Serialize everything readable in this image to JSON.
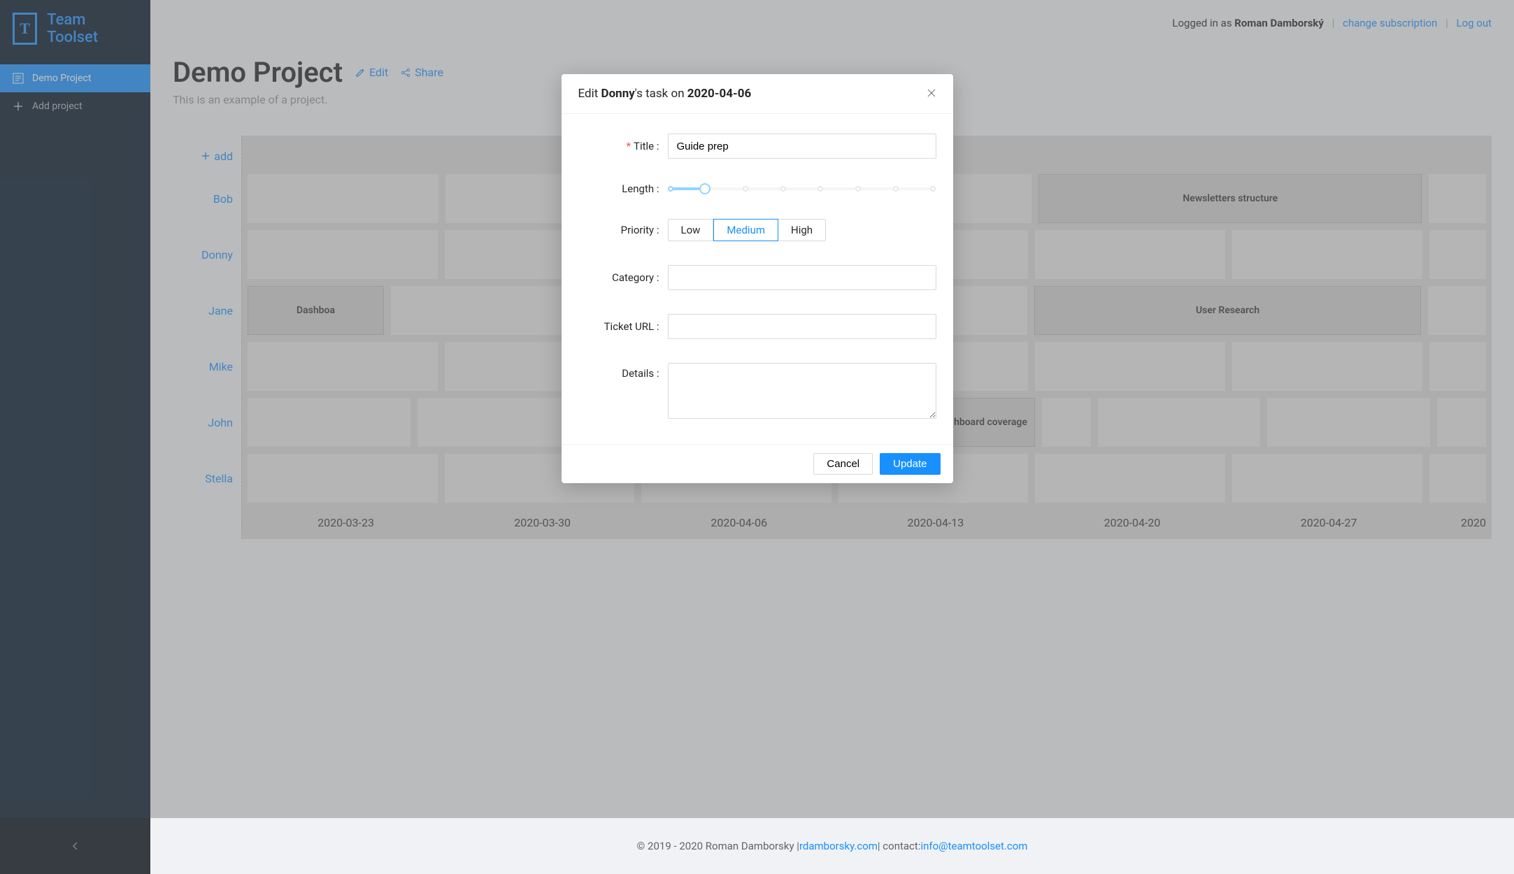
{
  "brand": "Team Toolset",
  "sidebar": {
    "items": [
      {
        "label": "Demo Project"
      },
      {
        "label": "Add project"
      }
    ]
  },
  "header": {
    "logged_in_prefix": "Logged in as ",
    "user": "Roman Damborský",
    "change_subscription": "change subscription",
    "logout": "Log out"
  },
  "project": {
    "title": "Demo Project",
    "subtitle": "This is an example of a project.",
    "edit": "Edit",
    "share": "Share"
  },
  "timeline": {
    "add": "add",
    "rows": [
      "Bob",
      "Donny",
      "Jane",
      "Mike",
      "John",
      "Stella"
    ],
    "dates": [
      "2020-03-23",
      "2020-03-30",
      "2020-04-06",
      "2020-04-13",
      "2020-04-20",
      "2020-04-27",
      "2020"
    ],
    "tasks": {
      "bob_newsletters": "Newsletters structure",
      "jane_dashboard": "Dashboa",
      "jane_research": "User Research",
      "john_coverage": "hboard coverage"
    }
  },
  "modal": {
    "title_prefix": "Edit ",
    "title_name": "Donny",
    "title_mid": "'s task on ",
    "title_date": "2020-04-06",
    "labels": {
      "title": "Title",
      "length": "Length",
      "priority": "Priority",
      "category": "Category",
      "ticket_url": "Ticket URL",
      "details": "Details"
    },
    "title_value": "Guide prep",
    "priority": {
      "low": "Low",
      "medium": "Medium",
      "high": "High"
    },
    "cancel": "Cancel",
    "update": "Update"
  },
  "footer": {
    "copyright": "© 2019 - 2020 Roman Damborsky | ",
    "site": "rdamborsky.com",
    "contact_prefix": " | contact: ",
    "email": "info@teamtoolset.com"
  }
}
